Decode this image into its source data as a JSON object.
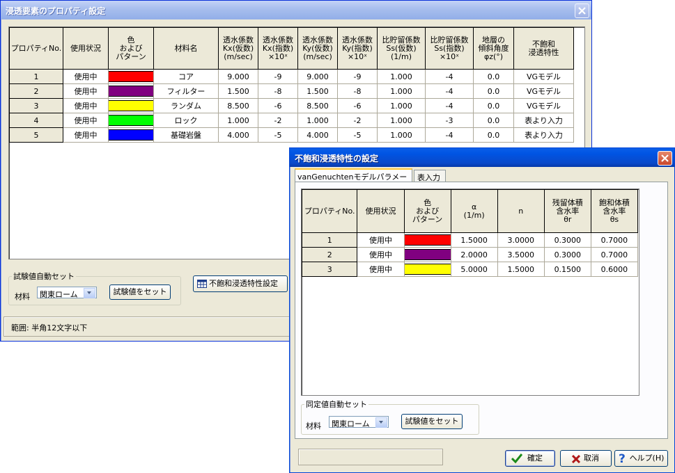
{
  "win1": {
    "title": "浸透要素のプロパティ設定",
    "headers": [
      "プロパティNo.",
      "使用状況",
      "色\nおよび\nパターン",
      "材料名",
      "透水係数\nKx(仮数)\n(m/sec)",
      "透水係数\nKx(指数)\n×10ˣ",
      "透水係数\nKy(仮数)\n(m/sec)",
      "透水係数\nKy(指数)\n×10ˣ",
      "比貯留係数\nSs(仮数)\n(1/m)",
      "比貯留係数\nSs(指数)\n×10ˣ",
      "地層の\n傾斜角度\nφz(°)",
      "不飽和\n浸透特性"
    ],
    "rows": [
      {
        "no": "1",
        "status": "使用中",
        "color": "#ff0000",
        "material": "コア",
        "kx": "9.000",
        "kxe": "-9",
        "ky": "9.000",
        "kye": "-9",
        "ss": "1.000",
        "sse": "-4",
        "phi": "0.0",
        "unsat": "VGモデル"
      },
      {
        "no": "2",
        "status": "使用中",
        "color": "#800080",
        "material": "フィルター",
        "kx": "1.500",
        "kxe": "-8",
        "ky": "1.500",
        "kye": "-8",
        "ss": "1.000",
        "sse": "-4",
        "phi": "0.0",
        "unsat": "VGモデル"
      },
      {
        "no": "3",
        "status": "使用中",
        "color": "#ffff00",
        "material": "ランダム",
        "kx": "8.500",
        "kxe": "-6",
        "ky": "8.500",
        "kye": "-6",
        "ss": "1.000",
        "sse": "-4",
        "phi": "0.0",
        "unsat": "VGモデル"
      },
      {
        "no": "4",
        "status": "使用中",
        "color": "#00ff00",
        "material": "ロック",
        "kx": "1.000",
        "kxe": "-2",
        "ky": "1.000",
        "kye": "-2",
        "ss": "1.000",
        "sse": "-3",
        "phi": "0.0",
        "unsat": "表より入力"
      },
      {
        "no": "5",
        "status": "使用中",
        "color": "#0000ff",
        "material": "基礎岩盤",
        "kx": "4.000",
        "kxe": "-5",
        "ky": "4.000",
        "kye": "-5",
        "ss": "1.000",
        "sse": "-4",
        "phi": "0.0",
        "unsat": "表より入力"
      }
    ],
    "group_label": "試験値自動セット",
    "material_label": "材料",
    "material_value": "関東ローム",
    "set_button": "試験値をセット",
    "unsat_button": "不飽和浸透特性設定",
    "status_text": "範囲:  半角12文字以下"
  },
  "win2": {
    "title": "不飽和浸透特性の設定",
    "tabs": [
      "vanGenuchtenモデルパラメータ",
      "表入力"
    ],
    "headers": [
      "プロパティNo.",
      "使用状況",
      "色\nおよび\nパターン",
      "α\n(1/m)",
      "n",
      "残留体積\n含水率\nθr",
      "飽和体積\n含水率\nθs"
    ],
    "rows": [
      {
        "no": "1",
        "status": "使用中",
        "color": "#ff0000",
        "alpha": "1.5000",
        "n": "3.0000",
        "tr": "0.3000",
        "ts": "0.7000"
      },
      {
        "no": "2",
        "status": "使用中",
        "color": "#800080",
        "alpha": "2.0000",
        "n": "3.5000",
        "tr": "0.3000",
        "ts": "0.7000"
      },
      {
        "no": "3",
        "status": "使用中",
        "color": "#ffff00",
        "alpha": "5.0000",
        "n": "1.5000",
        "tr": "0.1500",
        "ts": "0.6000"
      }
    ],
    "group_label": "同定値自動セット",
    "material_label": "材料",
    "material_value": "関東ローム",
    "set_button": "試験値をセット",
    "ok_button": "確定",
    "cancel_button": "取消",
    "help_button": "ヘルプ(H)"
  }
}
